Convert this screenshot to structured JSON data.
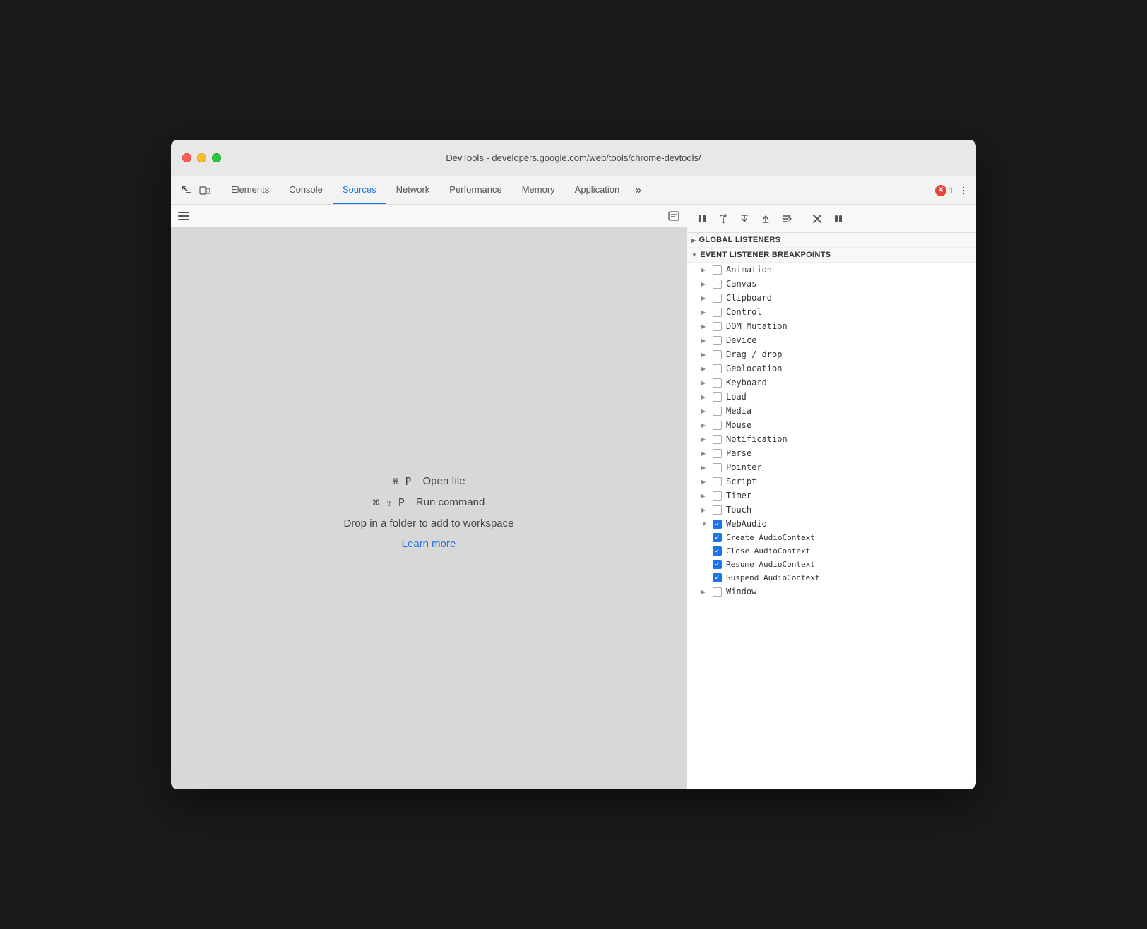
{
  "window": {
    "title": "DevTools - developers.google.com/web/tools/chrome-devtools/"
  },
  "tabs": {
    "items": [
      {
        "label": "Elements",
        "active": false
      },
      {
        "label": "Console",
        "active": false
      },
      {
        "label": "Sources",
        "active": true
      },
      {
        "label": "Network",
        "active": false
      },
      {
        "label": "Performance",
        "active": false
      },
      {
        "label": "Memory",
        "active": false
      },
      {
        "label": "Application",
        "active": false
      }
    ],
    "more_label": "»",
    "error_count": "1"
  },
  "sources": {
    "shortcut1": {
      "keys": "⌘ P",
      "action": "Open file"
    },
    "shortcut2": {
      "keys": "⌘ ⇧ P",
      "action": "Run command"
    },
    "drop_text": "Drop in a folder to add to workspace",
    "learn_more": "Learn more"
  },
  "debugger": {
    "toolbar": {
      "pause_label": "⏸",
      "resume_label": "↺",
      "step_over_label": "↓",
      "step_into_label": "↑",
      "step_out_label": "→",
      "deactivate_label": "⚡",
      "pause_exceptions_label": "⏸"
    }
  },
  "event_breakpoints": {
    "section_label": "Event Listener Breakpoints",
    "global_listeners_label": "Global Listeners",
    "items": [
      {
        "name": "Animation",
        "checked": false,
        "expanded": false
      },
      {
        "name": "Canvas",
        "checked": false,
        "expanded": false
      },
      {
        "name": "Clipboard",
        "checked": false,
        "expanded": false
      },
      {
        "name": "Control",
        "checked": false,
        "expanded": false
      },
      {
        "name": "DOM Mutation",
        "checked": false,
        "expanded": false
      },
      {
        "name": "Device",
        "checked": false,
        "expanded": false
      },
      {
        "name": "Drag / drop",
        "checked": false,
        "expanded": false
      },
      {
        "name": "Geolocation",
        "checked": false,
        "expanded": false
      },
      {
        "name": "Keyboard",
        "checked": false,
        "expanded": false
      },
      {
        "name": "Load",
        "checked": false,
        "expanded": false
      },
      {
        "name": "Media",
        "checked": false,
        "expanded": false
      },
      {
        "name": "Mouse",
        "checked": false,
        "expanded": false
      },
      {
        "name": "Notification",
        "checked": false,
        "expanded": false
      },
      {
        "name": "Parse",
        "checked": false,
        "expanded": false
      },
      {
        "name": "Pointer",
        "checked": false,
        "expanded": false
      },
      {
        "name": "Script",
        "checked": false,
        "expanded": false
      },
      {
        "name": "Timer",
        "checked": false,
        "expanded": false
      },
      {
        "name": "Touch",
        "checked": false,
        "expanded": false
      },
      {
        "name": "WebAudio",
        "checked": true,
        "expanded": true
      },
      {
        "name": "Window",
        "checked": false,
        "expanded": false
      }
    ],
    "web_audio_children": [
      {
        "name": "Create AudioContext",
        "checked": true
      },
      {
        "name": "Close AudioContext",
        "checked": true
      },
      {
        "name": "Resume AudioContext",
        "checked": true
      },
      {
        "name": "Suspend AudioContext",
        "checked": true
      }
    ]
  }
}
